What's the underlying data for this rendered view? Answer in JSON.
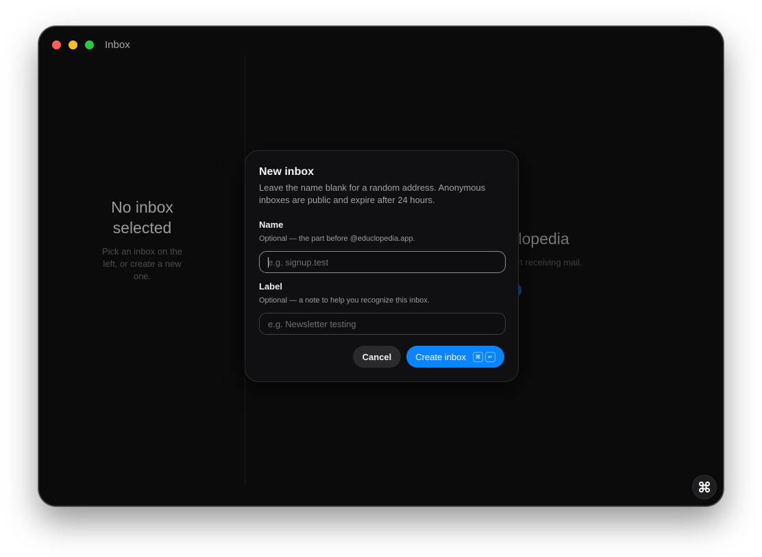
{
  "window": {
    "title": "Inbox"
  },
  "sidebar": {
    "empty_title": "No inbox selected",
    "empty_subtitle": "Pick an inbox on the left, or create a new one."
  },
  "main": {
    "brand_partial": "clopedia",
    "subtitle_partial": "rt receiving mail."
  },
  "modal": {
    "title": "New inbox",
    "description": "Leave the name blank for a random address. Anonymous inboxes are public and expire after 24 hours.",
    "name": {
      "label": "Name",
      "hint": "Optional — the part before @educlopedia.app.",
      "placeholder": "e.g. signup.test",
      "value": ""
    },
    "label": {
      "label": "Label",
      "hint": "Optional — a note to help you recognize this inbox.",
      "placeholder": "e.g. Newsletter testing",
      "value": ""
    },
    "cancel_label": "Cancel",
    "create_label": "Create inbox",
    "shortcut_keys": [
      "⌘",
      "↵"
    ]
  },
  "colors": {
    "accent": "#0a84ff",
    "window_bg": "#0b0b0c",
    "modal_bg": "#101012"
  },
  "icons": {
    "fab": "command-icon"
  }
}
